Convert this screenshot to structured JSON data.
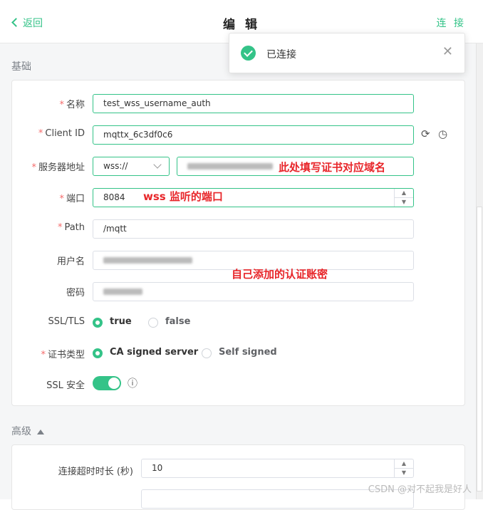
{
  "header": {
    "back_label": "返回",
    "title": "编 辑",
    "connect_label": "连 接"
  },
  "toast": {
    "message": "已连接",
    "icon": "check-circle-icon"
  },
  "sections": {
    "basic": "基础",
    "advanced": "高级"
  },
  "form": {
    "name": {
      "label": "名称",
      "value": "test_wss_username_auth"
    },
    "client_id": {
      "label": "Client ID",
      "value": "mqttx_6c3df0c6"
    },
    "host": {
      "label": "服务器地址",
      "protocol": "wss://"
    },
    "port": {
      "label": "端口",
      "value": "8084"
    },
    "path": {
      "label": "Path",
      "value": "/mqtt"
    },
    "username": {
      "label": "用户名"
    },
    "password": {
      "label": "密码"
    },
    "ssl": {
      "label": "SSL/TLS",
      "options": [
        "true",
        "false"
      ],
      "selected": "true"
    },
    "cert": {
      "label": "证书类型",
      "options": [
        "CA signed server",
        "Self signed"
      ],
      "selected": "CA signed server"
    },
    "ssl_secure": {
      "label": "SSL 安全",
      "enabled": true
    }
  },
  "advanced": {
    "timeout": {
      "label": "连接超时时长 (秒)",
      "value": "10"
    }
  },
  "annotations": {
    "host_note": "此处填写证书对应域名",
    "port_note": "wss 监听的端口",
    "auth_note": "自己添加的认证账密"
  },
  "watermark": "CSDN @对不起我是好人",
  "colors": {
    "accent": "#34c388",
    "required": "#f56c6c",
    "annotation": "#e8262a"
  }
}
